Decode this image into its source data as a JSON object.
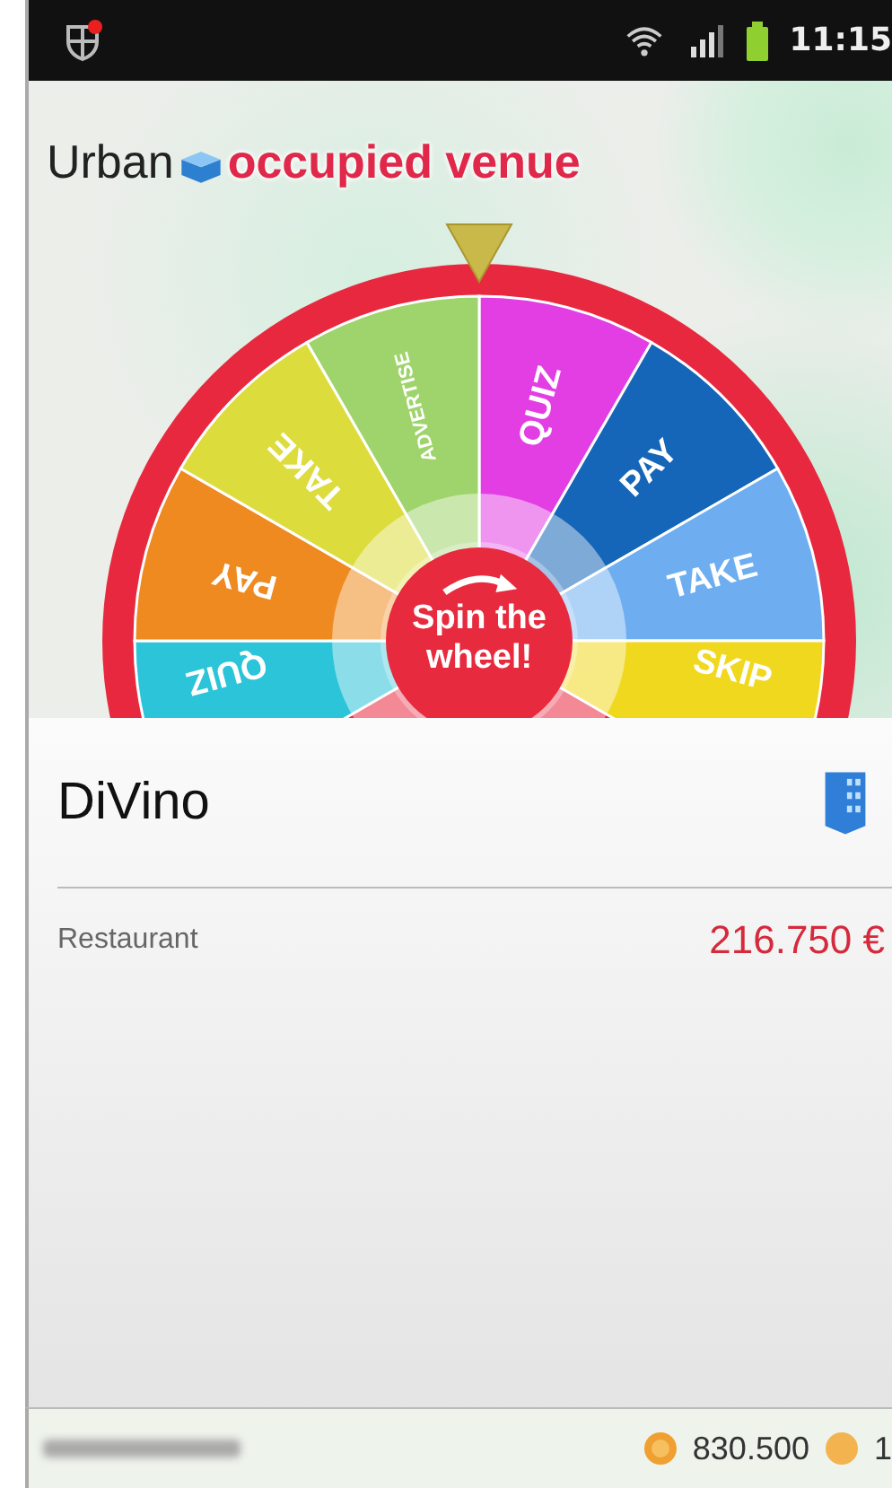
{
  "status_bar": {
    "time": "11:15"
  },
  "header": {
    "brand": "Urban",
    "title": "occupied venue"
  },
  "wheel": {
    "segments": [
      {
        "label": "QUIZ",
        "color": "#e23ee4"
      },
      {
        "label": "PAY",
        "color": "#1565b8"
      },
      {
        "label": "TAKE",
        "color": "#6eaef0"
      },
      {
        "label": "SKIP",
        "color": "#f0d81e"
      },
      {
        "label": "QUIZ",
        "color": "#2cc4d8"
      },
      {
        "label": "PAY",
        "color": "#ee8a20"
      },
      {
        "label": "TAKE",
        "color": "#dcdc3c"
      },
      {
        "label": "ADVERTISE",
        "color": "#9fd46c"
      }
    ],
    "button": {
      "label": "Spin the wheel!"
    }
  },
  "venue": {
    "name": "DiVino",
    "category": "Restaurant",
    "price": "216.750 €"
  },
  "footer": {
    "coins": "830.500",
    "second_value": "1"
  }
}
